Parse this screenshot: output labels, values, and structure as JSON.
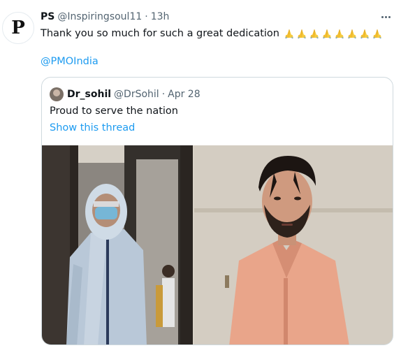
{
  "tweet": {
    "avatar_letter": "P",
    "name": "PS",
    "handle": "@Inspiringsoul11",
    "separator": "·",
    "time": "13h",
    "text": "Thank you so much for such a great dedication",
    "emoji_name": "folded-hands-emoji",
    "emoji_count": 8,
    "mention": "@PMOIndia"
  },
  "quoted": {
    "name": "Dr_sohil",
    "handle": "@DrSohil",
    "separator": "·",
    "time": "Apr 28",
    "text": "Proud to serve the nation",
    "link": "Show this thread"
  },
  "colors": {
    "link": "#1d9bf0",
    "secondary_text": "#536471",
    "border": "#cfd9de"
  }
}
